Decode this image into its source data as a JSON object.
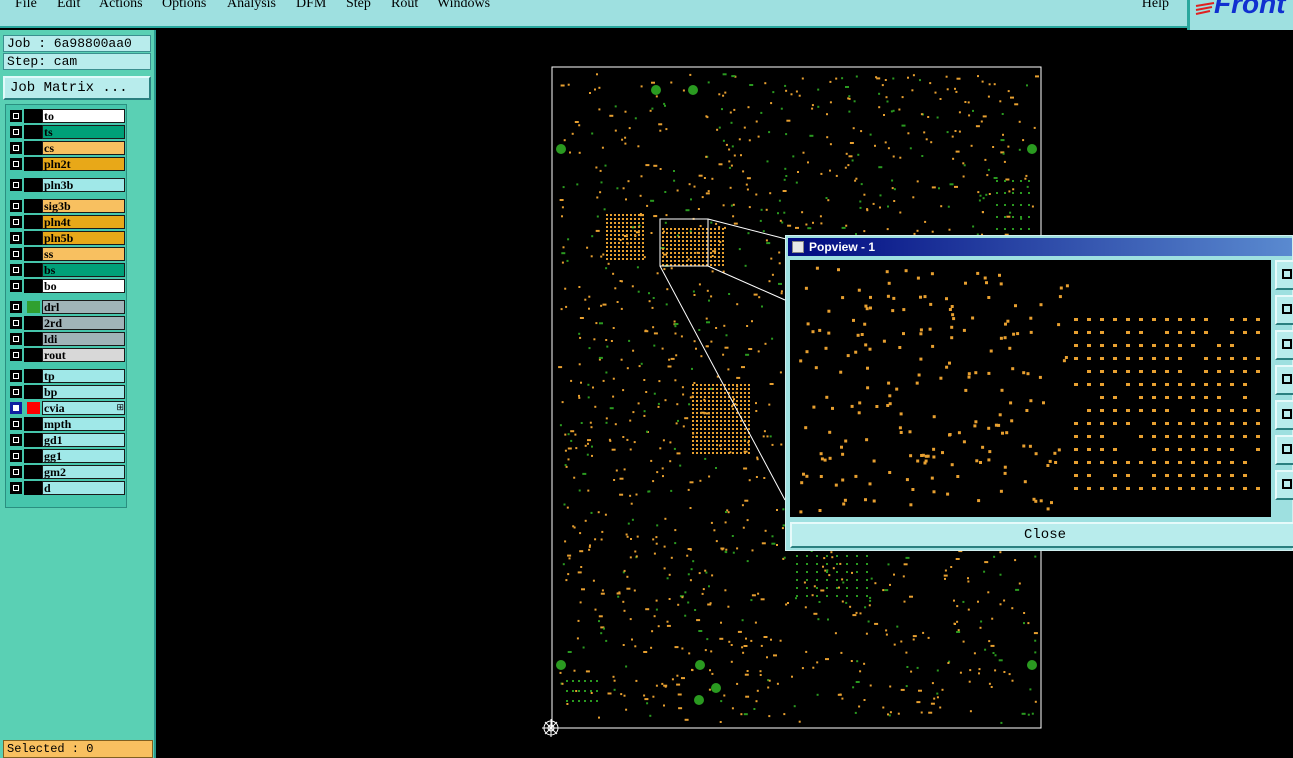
{
  "menu": {
    "items": [
      "File",
      "Edit",
      "Actions",
      "Options",
      "Analysis",
      "DFM",
      "Step",
      "Rout",
      "Windows"
    ],
    "help": "Help"
  },
  "logo": {
    "text": "Front"
  },
  "panel": {
    "job": "Job : 6a98800aa0",
    "step": "Step: cam",
    "job_matrix": "Job Matrix ...",
    "selected": "Selected : 0"
  },
  "layers": [
    {
      "name": "to",
      "color": "#ffffff",
      "group": 1
    },
    {
      "name": "ts",
      "color": "#00a078",
      "group": 1
    },
    {
      "name": "cs",
      "color": "#f8c060",
      "group": 1
    },
    {
      "name": "pln2t",
      "color": "#e8a818",
      "group": 1
    },
    {
      "name": "pln3b",
      "color": "#a0e8e8",
      "group": 2
    },
    {
      "name": "sig3b",
      "color": "#f8c060",
      "group": 3
    },
    {
      "name": "pln4t",
      "color": "#e8a818",
      "group": 3
    },
    {
      "name": "pln5b",
      "color": "#e8a818",
      "group": 3
    },
    {
      "name": "ss",
      "color": "#f8c060",
      "group": 3
    },
    {
      "name": "bs",
      "color": "#00a078",
      "group": 3
    },
    {
      "name": "bo",
      "color": "#ffffff",
      "group": 3
    },
    {
      "name": "drl",
      "color": "#a0b4b8",
      "group": 4,
      "swatch": "#30a030"
    },
    {
      "name": "2rd",
      "color": "#a0b4b8",
      "group": 4
    },
    {
      "name": "ldi",
      "color": "#a0b4b8",
      "group": 4
    },
    {
      "name": "rout",
      "color": "#d8d8d8",
      "group": 4
    },
    {
      "name": "tp",
      "color": "#a0e8e8",
      "group": 5
    },
    {
      "name": "bp",
      "color": "#a0e8e8",
      "group": 5
    },
    {
      "name": "cvia",
      "color": "#a0e8e8",
      "group": 5,
      "swatch": "#ff0000",
      "active": true,
      "mark": "⊞"
    },
    {
      "name": "mpth",
      "color": "#a0e8e8",
      "group": 5
    },
    {
      "name": "gd1",
      "color": "#a0e8e8",
      "group": 5
    },
    {
      "name": "gg1",
      "color": "#a0e8e8",
      "group": 5
    },
    {
      "name": "gm2",
      "color": "#a0e8e8",
      "group": 5
    },
    {
      "name": "d",
      "color": "#a0e8e8",
      "group": 5
    }
  ],
  "colors": {
    "pad": "#e8a030",
    "drill": "#2a9a20",
    "outline": "#ffffff"
  },
  "popview": {
    "title": "Popview - 1",
    "close_label": "Close"
  },
  "icons": {
    "popview_title": "window-icon",
    "origin": "crosshair-origin-icon"
  }
}
